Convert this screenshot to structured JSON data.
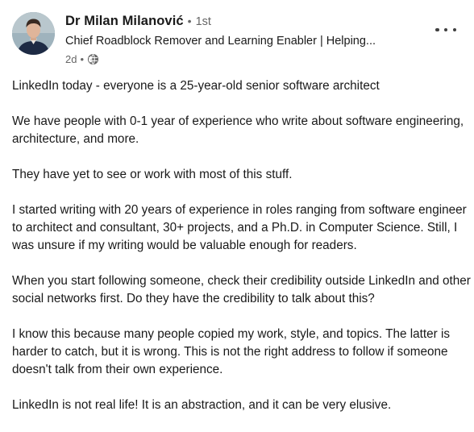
{
  "author": {
    "name": "Dr Milan Milanović",
    "separator": "•",
    "degree": "1st",
    "headline": "Chief Roadblock Remover and Learning Enabler | Helping...",
    "posted_ago": "2d",
    "meta_separator": "•",
    "visibility_icon": "globe-icon"
  },
  "actions": {
    "more_icon": "ellipsis-icon"
  },
  "post": {
    "paragraphs": [
      "LinkedIn today - everyone is a 25-year-old senior software architect",
      "We have people with 0-1 year of experience who write about software engineering, architecture, and more.",
      "They have yet to see or work with most of this stuff.",
      "I started writing with 20 years of experience in roles ranging from software engineer to architect and consultant, 30+ projects, and a Ph.D. in Computer Science. Still, I was unsure if my writing would be valuable enough for readers.",
      "When you start following someone, check their credibility outside LinkedIn and other social networks first. Do they have the credibility to talk about this?",
      "I know this because many people copied my work, style, and topics. The latter is harder to catch, but it is wrong. This is not the right address to follow if someone doesn't talk from their own experience.",
      "LinkedIn is not real life! It is an abstraction, and it can be very elusive."
    ]
  },
  "colors": {
    "text": "#191919",
    "secondary_text": "#666666",
    "background": "#ffffff"
  }
}
